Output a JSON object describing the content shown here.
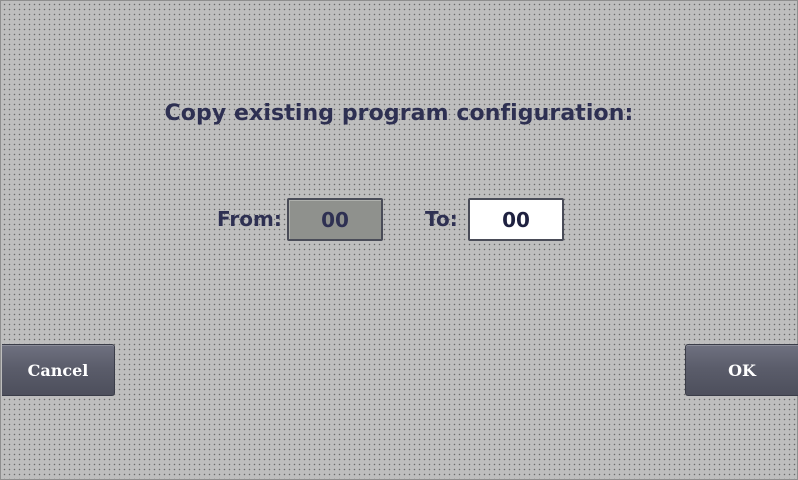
{
  "dialog": {
    "title": "Copy existing program configuration:",
    "from_label": "From:",
    "from_value": "00",
    "to_label": "To:",
    "to_value": "00"
  },
  "buttons": {
    "cancel_label": "Cancel",
    "ok_label": "OK"
  },
  "colors": {
    "background": "#bebebe",
    "text": "#2e3052",
    "button": "#5b5d6b",
    "from_field": "#8f918d",
    "to_field": "#ffffff"
  }
}
